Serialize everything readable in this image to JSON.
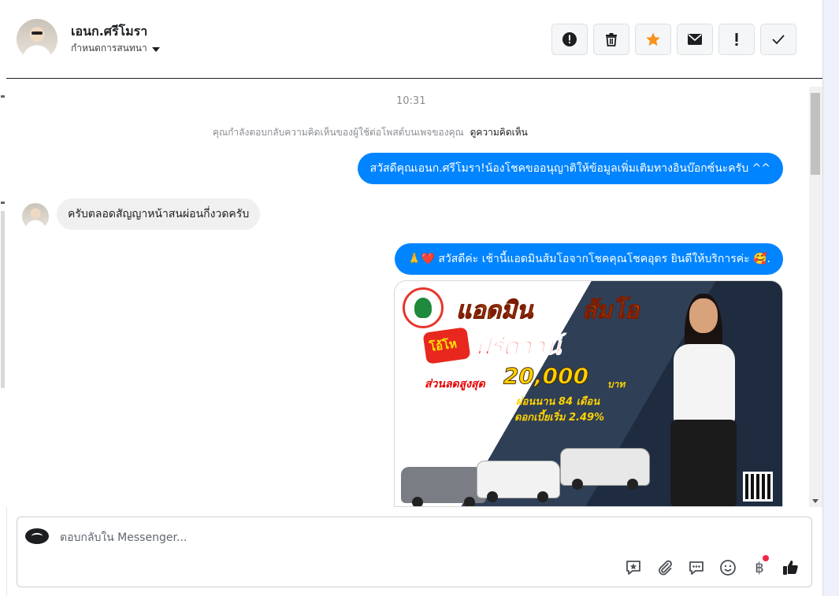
{
  "header": {
    "contact_name": "เอนก.ศรีโมรา",
    "assign_label": "กำหนดการสนทนา",
    "toolbar": [
      {
        "name": "alert-circle",
        "glyph": "!"
      },
      {
        "name": "trash",
        "glyph": "🗑"
      },
      {
        "name": "star",
        "glyph": "★"
      },
      {
        "name": "mail",
        "glyph": "✉"
      },
      {
        "name": "exclamation",
        "glyph": "!"
      },
      {
        "name": "check",
        "glyph": "✓"
      }
    ]
  },
  "chat": {
    "timestamp": "10:31",
    "notice_text": "คุณกำลังตอบกลับความคิดเห็นของผู้ใช้ต่อโพสต์บนเพจของคุณ",
    "notice_link": "ดูความคิดเห็น",
    "messages": [
      {
        "direction": "out",
        "text": "สวัสดีคุณเอนก.ศรีโมรา!น้องโชคขออนุญาติให้ข้อมูลเพิ่มเติมทางอินบ๊อกซ์นะครับ ^^"
      },
      {
        "direction": "in",
        "text": "ครับตลอดสัญญาหน้าสนผ่อนกี่งวดครับ"
      },
      {
        "direction": "out",
        "text": "🙏❤️ สวัสดีค่ะ เช้านี้แอดมินส้มโอจากโชคคุณโชคอุดร ยินดีให้บริการค่ะ 🥰."
      }
    ],
    "promo": {
      "title_left": "แอดมิน",
      "title_right": "ส้มโอ",
      "burst": "โอ้โห",
      "headline": "ฟรีดาวน์",
      "discount_label": "ส่วนลดสูงสุด",
      "amount": "20,000",
      "amount_unit": "บาท",
      "installments": "ผ่อนนาน 84 เดือน",
      "interest": "ดอกเบี้ยเริ่ม 2.49%"
    }
  },
  "composer": {
    "placeholder": "ตอบกลับใน Messenger...",
    "icons": [
      "star-message-icon",
      "attachment-icon",
      "chat-bubbles-icon",
      "emoji-icon",
      "baht-icon",
      "thumbs-up-icon"
    ]
  },
  "colors": {
    "accent": "#0084ff",
    "incoming_bubble": "#f0f0f0",
    "notification_dot": "#f02849"
  }
}
